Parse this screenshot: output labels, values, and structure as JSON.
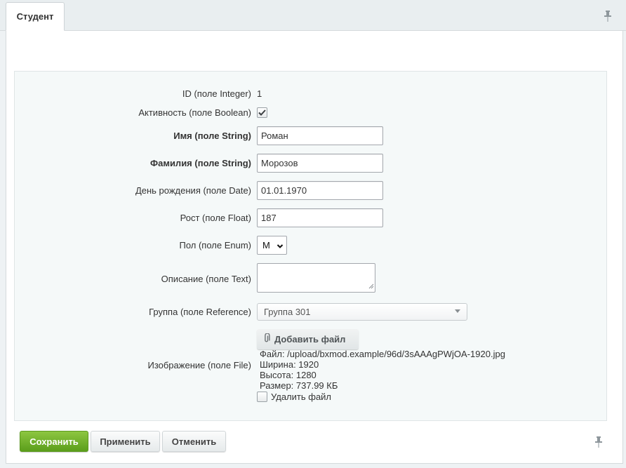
{
  "tab": {
    "label": "Студент"
  },
  "fields": {
    "id": {
      "label": "ID (поле Integer)",
      "value": "1"
    },
    "active": {
      "label": "Активность (поле Boolean)",
      "checked": true
    },
    "name": {
      "label": "Имя (поле String)",
      "value": "Роман"
    },
    "surname": {
      "label": "Фамилия (поле String)",
      "value": "Морозов"
    },
    "birthday": {
      "label": "День рождения (поле Date)",
      "value": "01.01.1970"
    },
    "height": {
      "label": "Рост (поле Float)",
      "value": "187"
    },
    "gender": {
      "label": "Пол (поле Enum)",
      "value": "М"
    },
    "description": {
      "label": "Описание (поле Text)",
      "value": ""
    },
    "group": {
      "label": "Группа (поле Reference)",
      "value": "Группа 301"
    },
    "image": {
      "label": "Изображение (поле File)",
      "add_button": "Добавить файл",
      "file_line": "Файл: /upload/bxmod.example/96d/3sAAAgPWjOA-1920.jpg",
      "width_line": "Ширина: 1920",
      "height_line": "Высота: 1280",
      "size_line": "Размер: 737.99 КБ",
      "delete_label": "Удалить файл",
      "delete_checked": false
    }
  },
  "buttons": {
    "save": "Сохранить",
    "apply": "Применить",
    "cancel": "Отменить"
  },
  "icons": {
    "pin": "pin-icon",
    "paperclip": "paperclip-icon",
    "check": "checkmark-icon"
  },
  "colors": {
    "save_button": "#6bb12a",
    "background": "#eef2f4",
    "form_area": "#f5f9f9"
  }
}
